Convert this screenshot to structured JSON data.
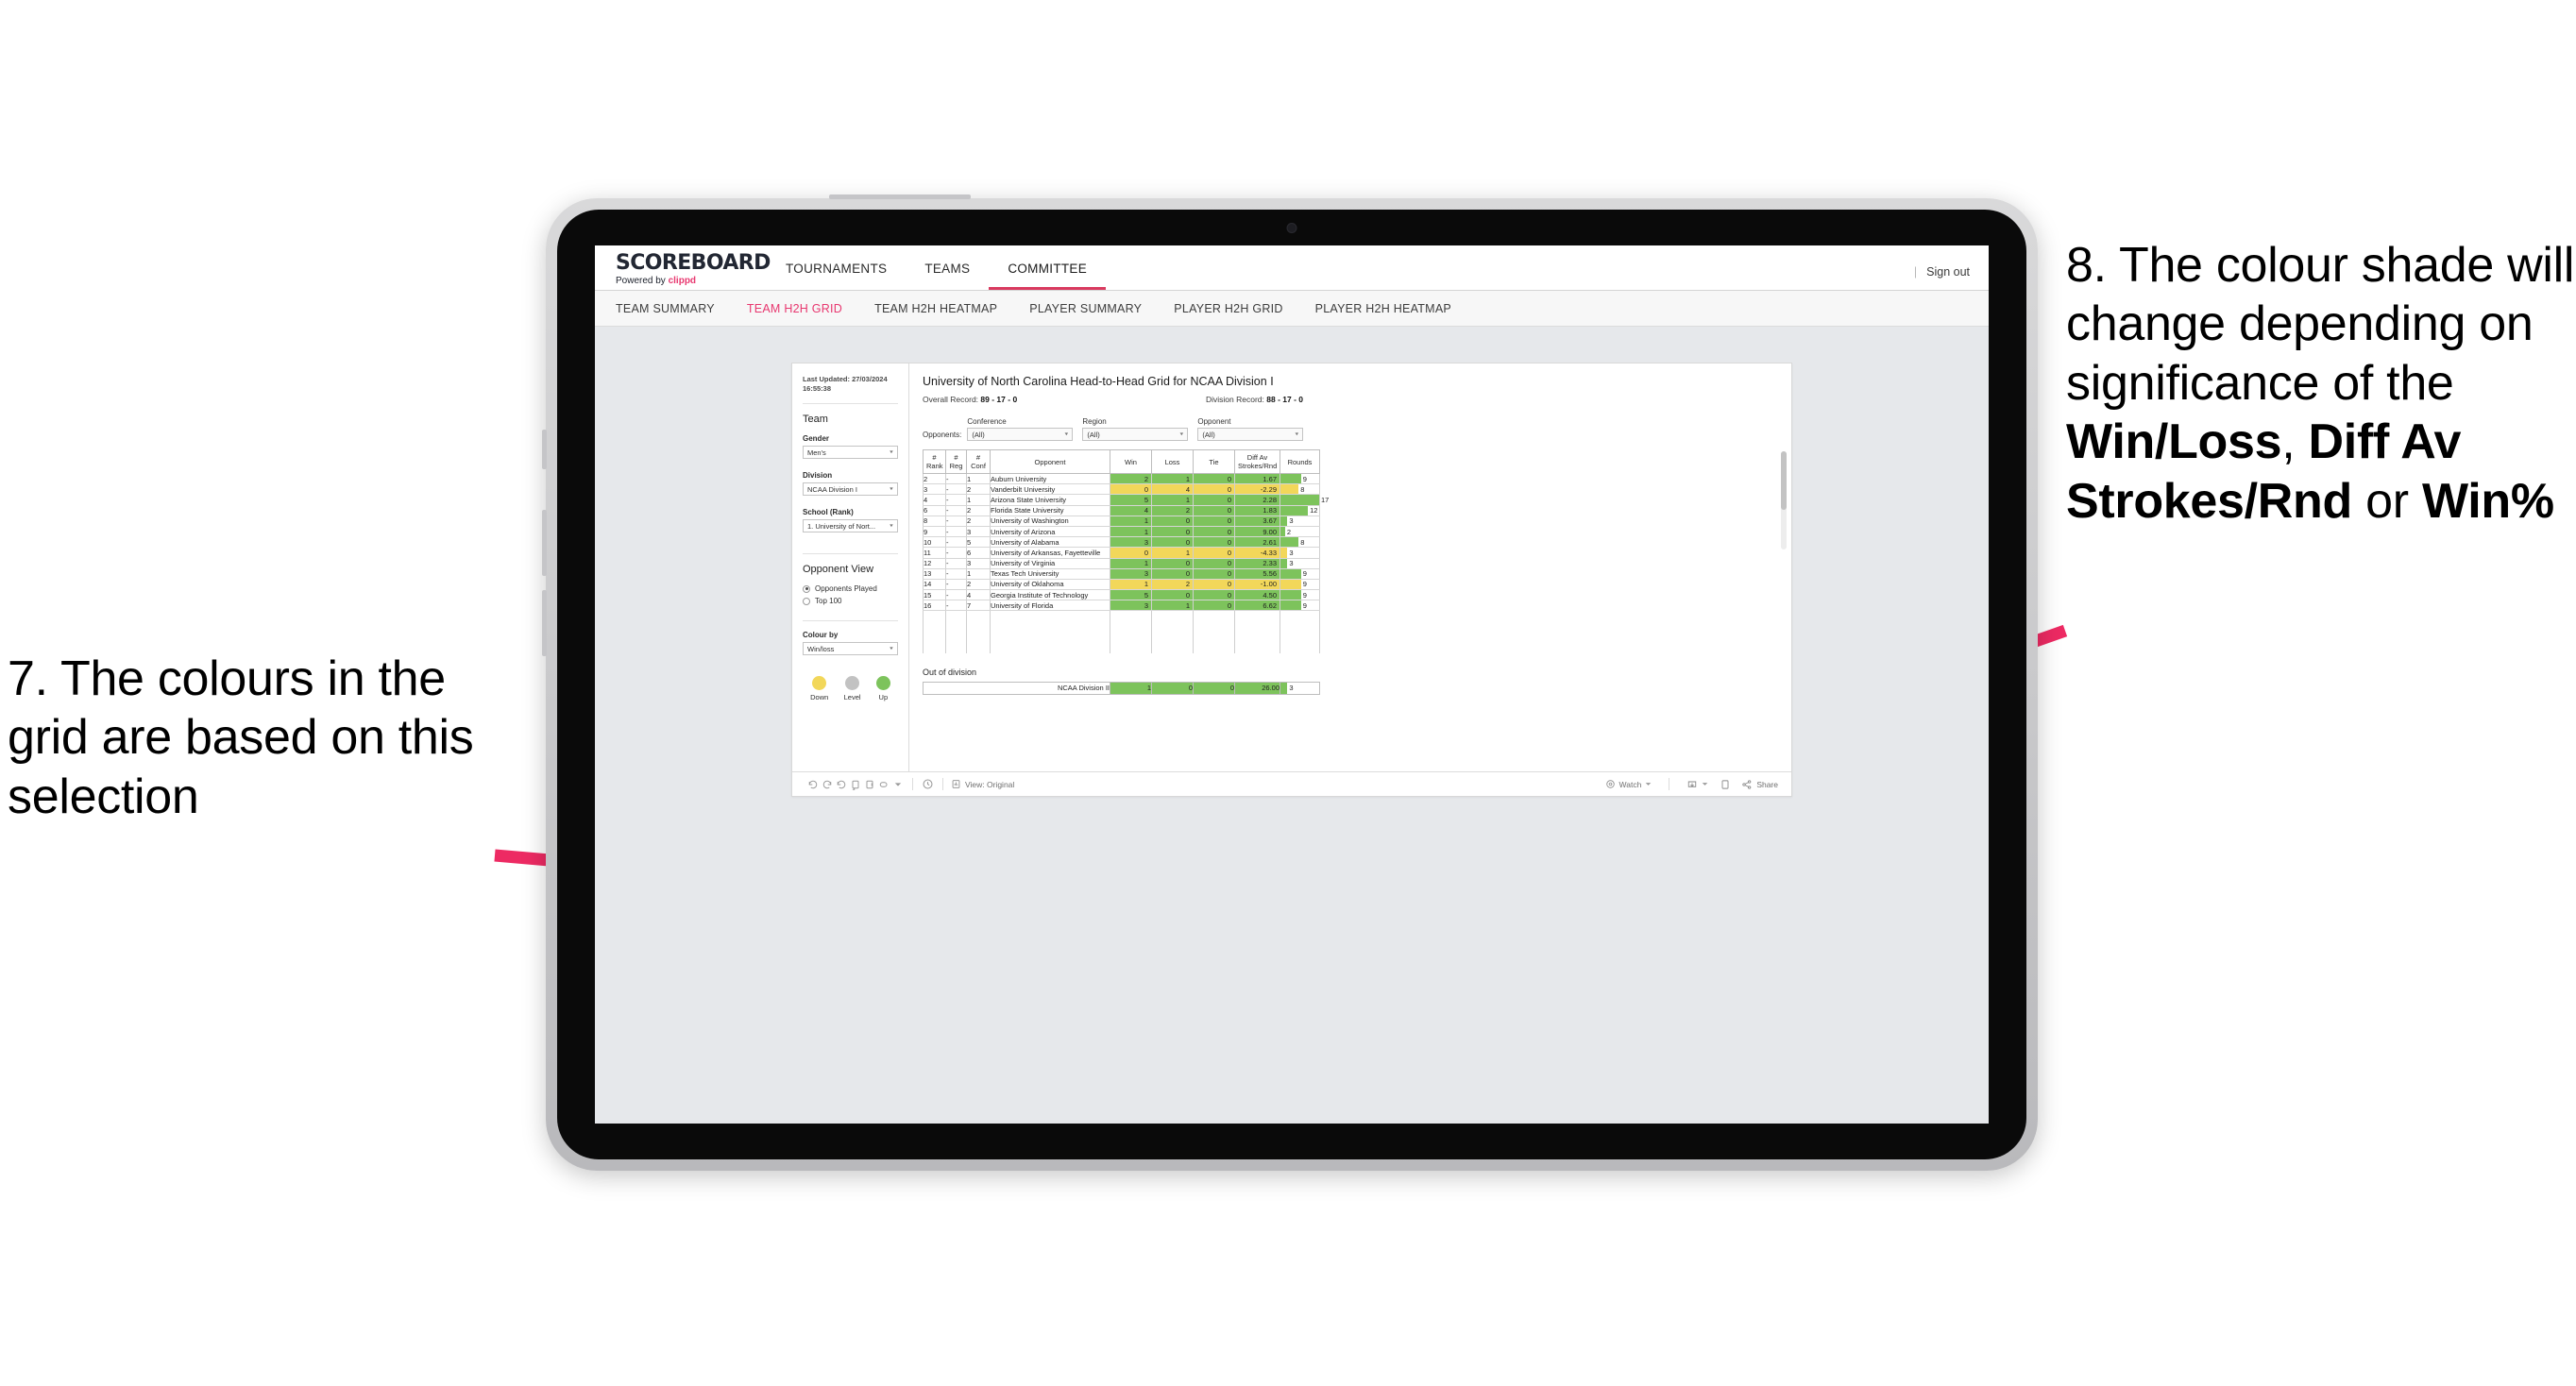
{
  "annotations": {
    "left": {
      "number": "7.",
      "text": "7. The colours in the grid are based on this selection"
    },
    "right": {
      "line1": "8. The colour shade will change depending on significance of the ",
      "bold1": "Win/Loss",
      "mid1": ", ",
      "bold2": "Diff Av Strokes/Rnd",
      "mid2": " or ",
      "bold3": "Win%"
    }
  },
  "header": {
    "logo_word": "SCOREBOARD",
    "logo_sub_prefix": "Powered by ",
    "logo_brand": "clippd",
    "nav": [
      {
        "label": "TOURNAMENTS",
        "active": false
      },
      {
        "label": "TEAMS",
        "active": false
      },
      {
        "label": "COMMITTEE",
        "active": true
      }
    ],
    "divider": "|",
    "sign_out": "Sign out"
  },
  "subnav": [
    {
      "label": "TEAM SUMMARY",
      "active": false
    },
    {
      "label": "TEAM H2H GRID",
      "active": true
    },
    {
      "label": "TEAM H2H HEATMAP",
      "active": false
    },
    {
      "label": "PLAYER SUMMARY",
      "active": false
    },
    {
      "label": "PLAYER H2H GRID",
      "active": false
    },
    {
      "label": "PLAYER H2H HEATMAP",
      "active": false
    }
  ],
  "sidebar": {
    "last_updated": "Last Updated: 27/03/2024 16:55:38",
    "team_title": "Team",
    "gender_label": "Gender",
    "gender_value": "Men's",
    "division_label": "Division",
    "division_value": "NCAA Division I",
    "school_label": "School (Rank)",
    "school_value": "1. University of Nort...",
    "opponent_view_title": "Opponent View",
    "radio_opponents_played": "Opponents Played",
    "radio_top100": "Top 100",
    "colour_by_label": "Colour by",
    "colour_by_value": "Win/loss",
    "legend": [
      {
        "label": "Down",
        "color": "#F2D75A"
      },
      {
        "label": "Level",
        "color": "#C2C2C2"
      },
      {
        "label": "Up",
        "color": "#7DC35C"
      }
    ]
  },
  "viz": {
    "title": "University of North Carolina Head-to-Head Grid for NCAA Division I",
    "overall_record_label": "Overall Record: ",
    "overall_record_value": "89 - 17 - 0",
    "division_record_label": "Division Record: ",
    "division_record_value": "88 - 17 - 0",
    "opponents_label": "Opponents:",
    "filters": [
      {
        "label": "Conference",
        "value": "(All)"
      },
      {
        "label": "Region",
        "value": "(All)"
      },
      {
        "label": "Opponent",
        "value": "(All)"
      }
    ],
    "columns": [
      "# Rank",
      "# Reg",
      "# Conf",
      "Opponent",
      "Win",
      "Loss",
      "Tie",
      "Diff Av Strokes/Rnd",
      "Rounds"
    ],
    "col_rank": "# Rank",
    "col_reg": "# Reg",
    "col_conf": "# Conf",
    "col_opponent": "Opponent",
    "col_win": "Win",
    "col_loss": "Loss",
    "col_tie": "Tie",
    "col_diff": "Diff Av Strokes/Rnd",
    "col_rounds": "Rounds",
    "out_of_division_title": "Out of division",
    "out_of_division_row": {
      "name": "NCAA Division II",
      "win": "1",
      "loss": "0",
      "tie": "0",
      "diff": "26.00",
      "rounds": "3",
      "status": "up"
    }
  },
  "chart_data": {
    "type": "table",
    "title": "University of North Carolina Head-to-Head Grid for NCAA Division I",
    "columns": [
      "# Rank",
      "# Reg",
      "# Conf",
      "Opponent",
      "Win",
      "Loss",
      "Tie",
      "Diff Av Strokes/Rnd",
      "Rounds"
    ],
    "colour_by": "Win/loss",
    "colour_scale": {
      "up": "#7DC35C",
      "level": "#C2C2C2",
      "down": "#F2D75A"
    },
    "rounds_max": 17,
    "rows": [
      {
        "rank": "2",
        "reg": "-",
        "conf": "1",
        "opponent": "Auburn University",
        "win": "2",
        "loss": "1",
        "tie": "0",
        "diff": "1.67",
        "rounds": "9",
        "status": "up"
      },
      {
        "rank": "3",
        "reg": "-",
        "conf": "2",
        "opponent": "Vanderbilt University",
        "win": "0",
        "loss": "4",
        "tie": "0",
        "diff": "-2.29",
        "rounds": "8",
        "status": "down"
      },
      {
        "rank": "4",
        "reg": "-",
        "conf": "1",
        "opponent": "Arizona State University",
        "win": "5",
        "loss": "1",
        "tie": "0",
        "diff": "2.28",
        "rounds": "17",
        "status": "up"
      },
      {
        "rank": "6",
        "reg": "-",
        "conf": "2",
        "opponent": "Florida State University",
        "win": "4",
        "loss": "2",
        "tie": "0",
        "diff": "1.83",
        "rounds": "12",
        "status": "up"
      },
      {
        "rank": "8",
        "reg": "-",
        "conf": "2",
        "opponent": "University of Washington",
        "win": "1",
        "loss": "0",
        "tie": "0",
        "diff": "3.67",
        "rounds": "3",
        "status": "up"
      },
      {
        "rank": "9",
        "reg": "-",
        "conf": "3",
        "opponent": "University of Arizona",
        "win": "1",
        "loss": "0",
        "tie": "0",
        "diff": "9.00",
        "rounds": "2",
        "status": "up"
      },
      {
        "rank": "10",
        "reg": "-",
        "conf": "5",
        "opponent": "University of Alabama",
        "win": "3",
        "loss": "0",
        "tie": "0",
        "diff": "2.61",
        "rounds": "8",
        "status": "up"
      },
      {
        "rank": "11",
        "reg": "-",
        "conf": "6",
        "opponent": "University of Arkansas, Fayetteville",
        "win": "0",
        "loss": "1",
        "tie": "0",
        "diff": "-4.33",
        "rounds": "3",
        "status": "down"
      },
      {
        "rank": "12",
        "reg": "-",
        "conf": "3",
        "opponent": "University of Virginia",
        "win": "1",
        "loss": "0",
        "tie": "0",
        "diff": "2.33",
        "rounds": "3",
        "status": "up"
      },
      {
        "rank": "13",
        "reg": "-",
        "conf": "1",
        "opponent": "Texas Tech University",
        "win": "3",
        "loss": "0",
        "tie": "0",
        "diff": "5.56",
        "rounds": "9",
        "status": "up"
      },
      {
        "rank": "14",
        "reg": "-",
        "conf": "2",
        "opponent": "University of Oklahoma",
        "win": "1",
        "loss": "2",
        "tie": "0",
        "diff": "-1.00",
        "rounds": "9",
        "status": "down"
      },
      {
        "rank": "15",
        "reg": "-",
        "conf": "4",
        "opponent": "Georgia Institute of Technology",
        "win": "5",
        "loss": "0",
        "tie": "0",
        "diff": "4.50",
        "rounds": "9",
        "status": "up"
      },
      {
        "rank": "16",
        "reg": "-",
        "conf": "7",
        "opponent": "University of Florida",
        "win": "3",
        "loss": "1",
        "tie": "0",
        "diff": "6.62",
        "rounds": "9",
        "status": "up"
      }
    ]
  },
  "toolbar": {
    "view_label": "View: Original",
    "watch_label": "Watch",
    "share_label": "Share"
  }
}
